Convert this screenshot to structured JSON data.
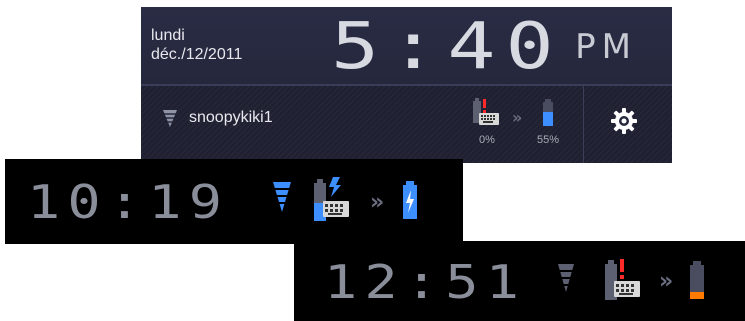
{
  "notification_shade": {
    "date_line1": "lundi",
    "date_line2": "déc./12/2011",
    "time": "5:40",
    "ampm": "PM",
    "wifi_ssid": "snoopykiki1",
    "keyboard_battery": "0%",
    "tablet_battery": "55%",
    "icons": [
      "wifi-icon",
      "keyboard-battery-alert-icon",
      "double-chevron-icon",
      "battery-icon",
      "settings-gear-icon"
    ]
  },
  "status_bar_2": {
    "time": "10:19",
    "icons": [
      "wifi-icon",
      "keyboard-battery-charging-icon",
      "double-chevron-icon",
      "battery-charging-icon"
    ]
  },
  "status_bar_3": {
    "time": "12:51",
    "icons": [
      "wifi-icon",
      "keyboard-battery-alert-icon",
      "double-chevron-icon",
      "battery-low-icon"
    ]
  },
  "colors": {
    "shade_bg": "#25273c",
    "accent_blue": "#3d8fff",
    "alert_red": "#ff2a2a",
    "low_orange": "#ff7a00"
  }
}
